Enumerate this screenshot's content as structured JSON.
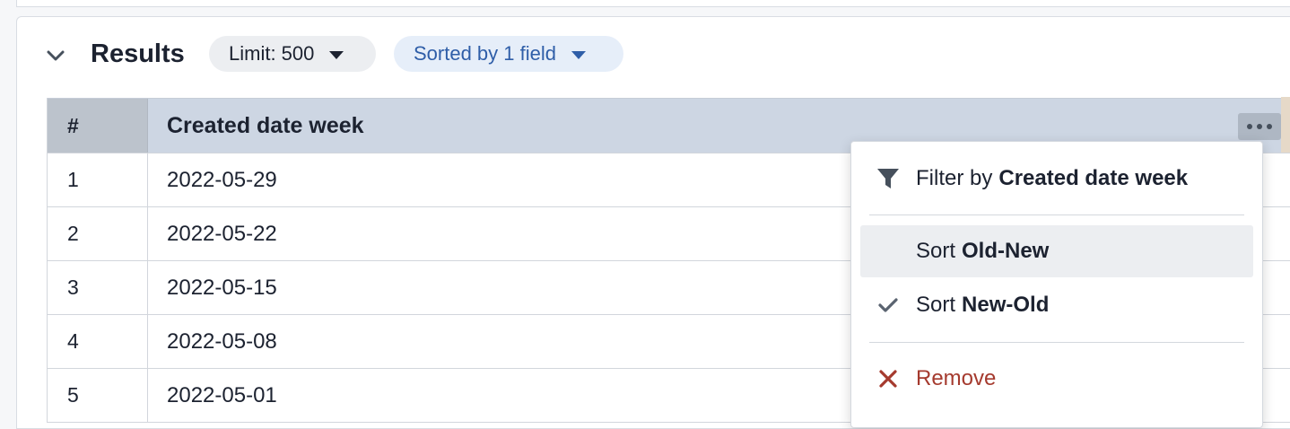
{
  "results": {
    "title": "Results",
    "limit_label": "Limit: 500",
    "sort_label": "Sorted by 1 field"
  },
  "table": {
    "headers": {
      "num": "#",
      "date": "Created date week"
    },
    "rows": [
      {
        "num": "1",
        "date": "2022-05-29"
      },
      {
        "num": "2",
        "date": "2022-05-22"
      },
      {
        "num": "3",
        "date": "2022-05-15"
      },
      {
        "num": "4",
        "date": "2022-05-08"
      },
      {
        "num": "5",
        "date": "2022-05-01"
      }
    ]
  },
  "menu": {
    "filter": {
      "prefix": "Filter by",
      "field": "Created date week",
      "icon": "filter-icon"
    },
    "sort_old_new": {
      "prefix": "Sort",
      "order": "Old-New"
    },
    "sort_new_old": {
      "prefix": "Sort",
      "order": "New-Old",
      "icon": "check-icon"
    },
    "remove": {
      "label": "Remove",
      "icon": "close-icon"
    }
  },
  "colors": {
    "accent_blue": "#2f5ea8",
    "remove_red": "#a53a2e",
    "header_bg": "#cdd6e3"
  }
}
